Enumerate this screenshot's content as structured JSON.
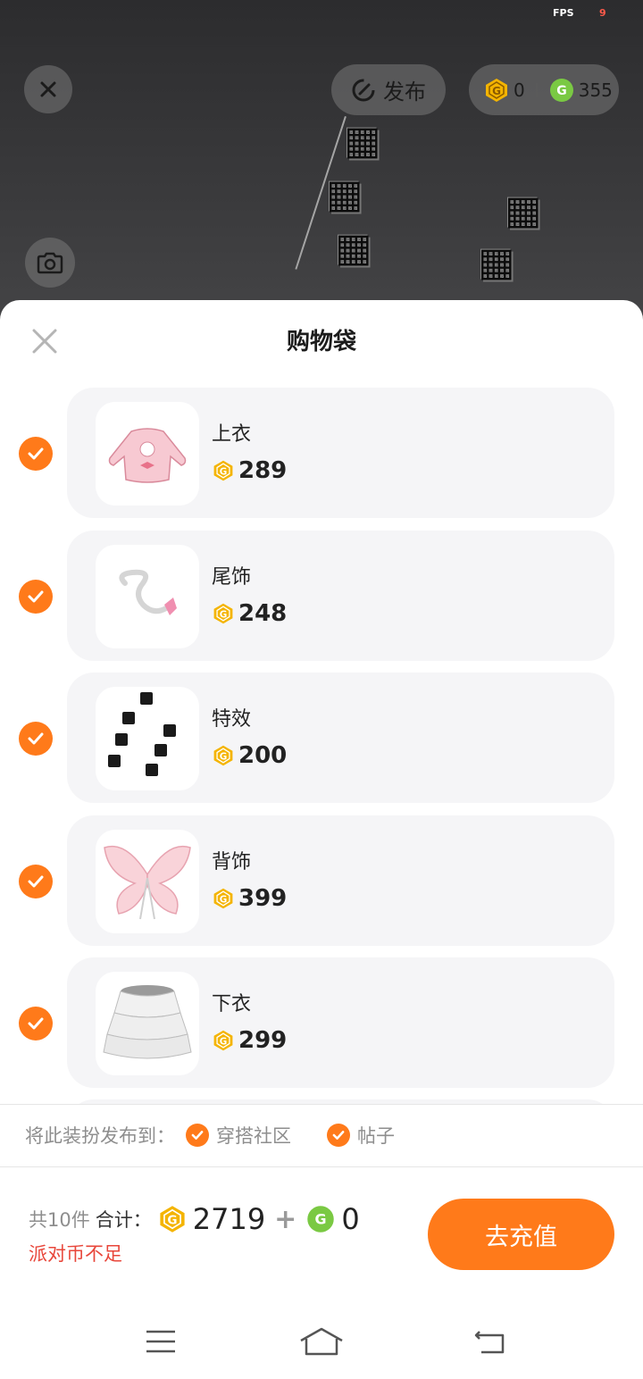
{
  "status": {
    "fps_label": "FPS",
    "fps_value": "9"
  },
  "top": {
    "publish_label": "发布",
    "gold_coins": "0",
    "green_coins": "355"
  },
  "sheet": {
    "title": "购物袋",
    "items": [
      {
        "name": "上衣",
        "price": "289",
        "checked": true
      },
      {
        "name": "尾饰",
        "price": "248",
        "checked": true
      },
      {
        "name": "特效",
        "price": "200",
        "checked": true
      },
      {
        "name": "背饰",
        "price": "399",
        "checked": true
      },
      {
        "name": "下衣",
        "price": "299",
        "checked": true
      }
    ],
    "publish_prompt": "将此装扮发布到：",
    "publish_options": [
      {
        "label": "穿搭社区",
        "checked": true
      },
      {
        "label": "帖子",
        "checked": true
      }
    ]
  },
  "footer": {
    "count_text": "共10件",
    "total_label": "合计：",
    "gold_total": "2719",
    "plus": "+",
    "green_total": "0",
    "warning": "派对币不足",
    "recharge_label": "去充值"
  },
  "colors": {
    "accent": "#ff7a1a",
    "gold_coin": "#f4b400",
    "green_coin": "#7ac943",
    "warning": "#e8463a"
  }
}
